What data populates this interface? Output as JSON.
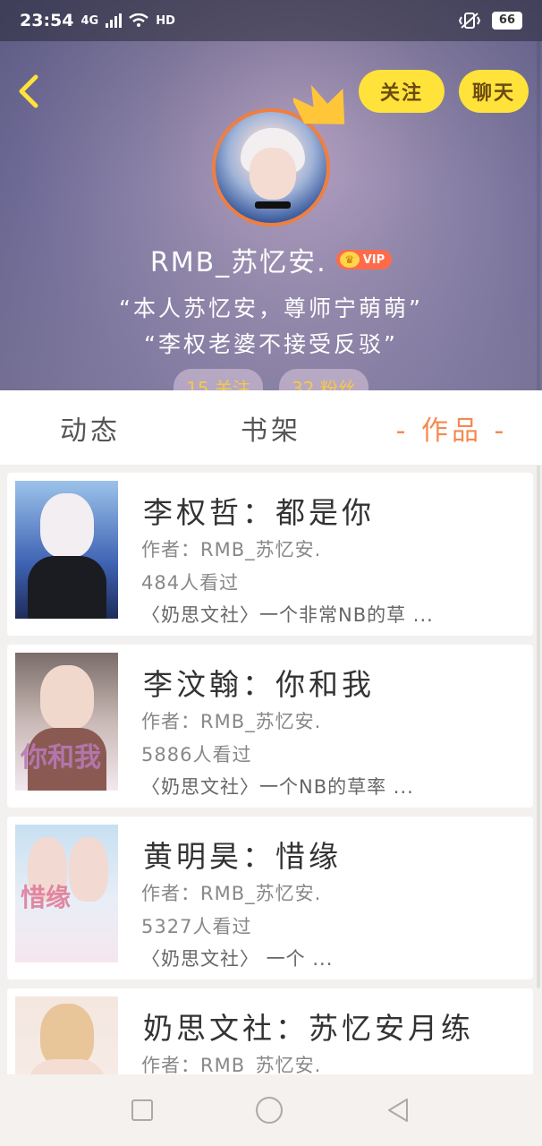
{
  "status_bar": {
    "time": "23:54",
    "network": "4G",
    "hd": "HD",
    "battery": "66"
  },
  "header": {
    "follow_label": "关注",
    "chat_label": "聊天",
    "username": "RMB_苏忆安.",
    "vip_label": "VIP",
    "bio_line1": "“本人苏忆安，尊师宁萌萌”",
    "bio_line2": "“李权老婆不接受反驳”",
    "following": "15 关注",
    "followers": "32 粉丝"
  },
  "tabs": [
    {
      "label": "动态"
    },
    {
      "label": "书架"
    },
    {
      "label": "- 作品 -",
      "active": true
    }
  ],
  "works": [
    {
      "title": "李权哲：都是你",
      "author": "作者：RMB_苏忆安.",
      "views": "484人看过",
      "desc": "〈奶思文社〉一个非常NB的草 ..."
    },
    {
      "title": "李汶翰：你和我",
      "author": "作者：RMB_苏忆安.",
      "views": "5886人看过",
      "desc": "〈奶思文社〉一个NB的草率 ..."
    },
    {
      "title": "黄明昊：惜缘",
      "author": "作者：RMB_苏忆安.",
      "views": "5327人看过",
      "desc": "〈奶思文社〉 一个 ..."
    },
    {
      "title": "奶思文社：苏忆安月练",
      "author": "作者：RMB_苏忆安.",
      "views": "",
      "desc": ""
    }
  ],
  "colors": {
    "accent": "#f5894f",
    "button": "#ffe23a",
    "avatar_ring": "#f07f3f"
  }
}
